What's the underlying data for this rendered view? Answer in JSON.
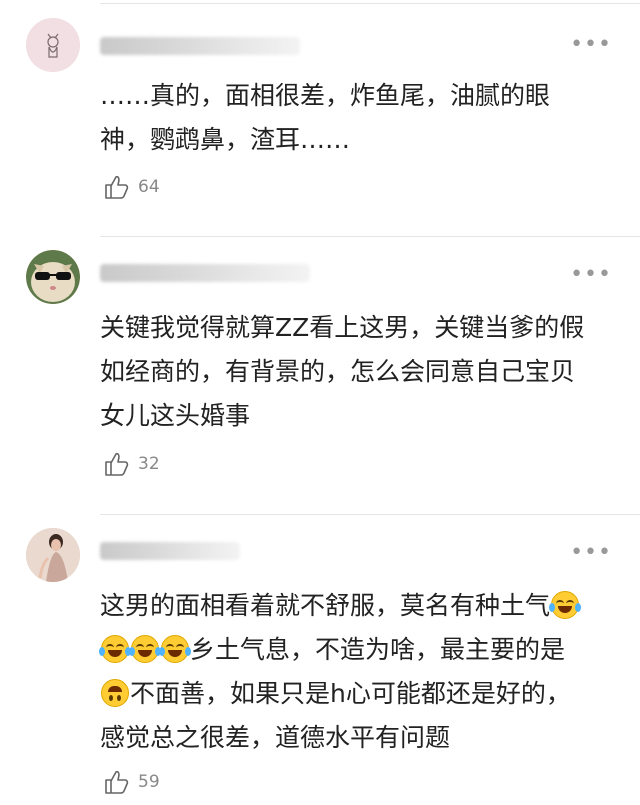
{
  "comments": [
    {
      "text_lines": [
        "……真的，面相很差，炸鱼尾，油腻的眼",
        "神，鹦鹉鼻，渣耳……"
      ],
      "likes": "64",
      "more": "•••",
      "avatar_icon": "cat-sketch-avatar"
    },
    {
      "text_lines": [
        "关键我觉得就算ZZ看上这男，关键当爹的假",
        "如经商的，有背景的，怎么会同意自己宝贝",
        "女儿这头婚事"
      ],
      "likes": "32",
      "more": "•••",
      "avatar_icon": "cat-sunglasses-avatar"
    },
    {
      "line1": "这男的面相看着就不舒服，莫名有种土气",
      "line2_after_emojis": "乡土气息，不造为啥，最主要的是",
      "line3_after_emoji": "不面善，如果只是h心可能都还是好的，",
      "line4": "感觉总之很差，道德水平有问题",
      "likes": "59",
      "more": "•••",
      "avatar_icon": "woman-photo-avatar"
    }
  ],
  "colors": {
    "text": "#222222",
    "muted": "#888888",
    "divider": "#e6e6e6",
    "emoji": "#ffcc33"
  }
}
